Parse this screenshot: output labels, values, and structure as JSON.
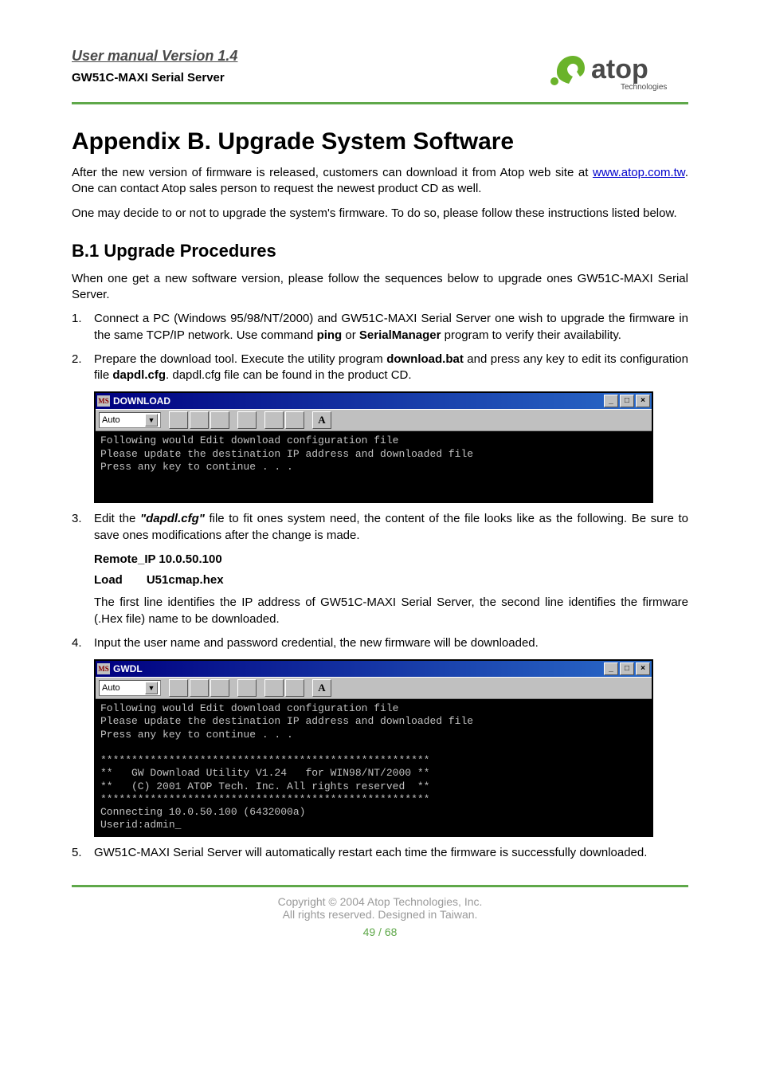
{
  "header": {
    "title": "User manual Version 1.4",
    "subtitle": "GW51C-MAXI Serial Server",
    "logo_main": "atop",
    "logo_sub": "Technologies"
  },
  "section": {
    "heading": "Appendix B. Upgrade System Software",
    "p1a": "After the new version of firmware is released, customers can download it from Atop web site at ",
    "p1_link": "www.atop.com.tw",
    "p1b": ". One can contact Atop sales person to request the newest product CD as well.",
    "p2": "One may decide to or not to upgrade the system's firmware. To do so, please follow these instructions listed below.",
    "subheading": "B.1 Upgrade Procedures",
    "p3": "When one get a new software version, please follow the sequences below to upgrade ones GW51C-MAXI Serial Server."
  },
  "steps": {
    "s1_num": "1.",
    "s1_a": "Connect a PC (Windows 95/98/NT/2000) and GW51C-MAXI Serial Server one wish to upgrade the firmware in the same TCP/IP network. Use command ",
    "s1_b": "ping",
    "s1_c": " or ",
    "s1_d": "SerialManager",
    "s1_e": " program to verify their availability.",
    "s2_num": "2.",
    "s2_a": "Prepare the download tool. Execute the utility program ",
    "s2_b": "download.bat",
    "s2_c": " and press any key to edit its configuration file ",
    "s2_d": "dapdl.cfg",
    "s2_e": ". dapdl.cfg file can be found in the product CD.",
    "s3_num": "3.",
    "s3_a": "Edit the ",
    "s3_b": "\"dapdl.cfg\"",
    "s3_c": " file to fit ones system need, the content of the file looks like as the following. Be sure to save ones modifications after the change is made.",
    "s4_num": "4.",
    "s4": "Input the user name and password credential, the new firmware will be downloaded.",
    "s5_num": "5.",
    "s5": "GW51C-MAXI Serial Server will automatically restart each time the firmware is successfully downloaded."
  },
  "cfg": {
    "k1": "Remote_IP 10.0.50.100",
    "k2": "Load",
    "v2": "U51cmap.hex",
    "note": "The first line identifies the IP address of GW51C-MAXI Serial Server, the second line identifies the firmware (.Hex file) name to be downloaded."
  },
  "console1": {
    "title": "DOWNLOAD",
    "font_select": "Auto",
    "body": "Following would Edit download configuration file\nPlease update the destination IP address and downloaded file\nPress any key to continue . . .\n"
  },
  "console2": {
    "title": "GWDL",
    "font_select": "Auto",
    "body": "Following would Edit download configuration file\nPlease update the destination IP address and downloaded file\nPress any key to continue . . .\n\n*****************************************************\n**   GW Download Utility V1.24   for WIN98/NT/2000 **\n**   (C) 2001 ATOP Tech. Inc. All rights reserved  **\n*****************************************************\nConnecting 10.0.50.100 (6432000a)\nUserid:admin_"
  },
  "win_controls": {
    "min": "_",
    "max": "□",
    "close": "×"
  },
  "toolbar_font_glyph": "A",
  "footer": {
    "c1": "Copyright © 2004 Atop Technologies, Inc.",
    "c2": "All rights reserved. Designed in Taiwan.",
    "page": "49 / 68"
  }
}
